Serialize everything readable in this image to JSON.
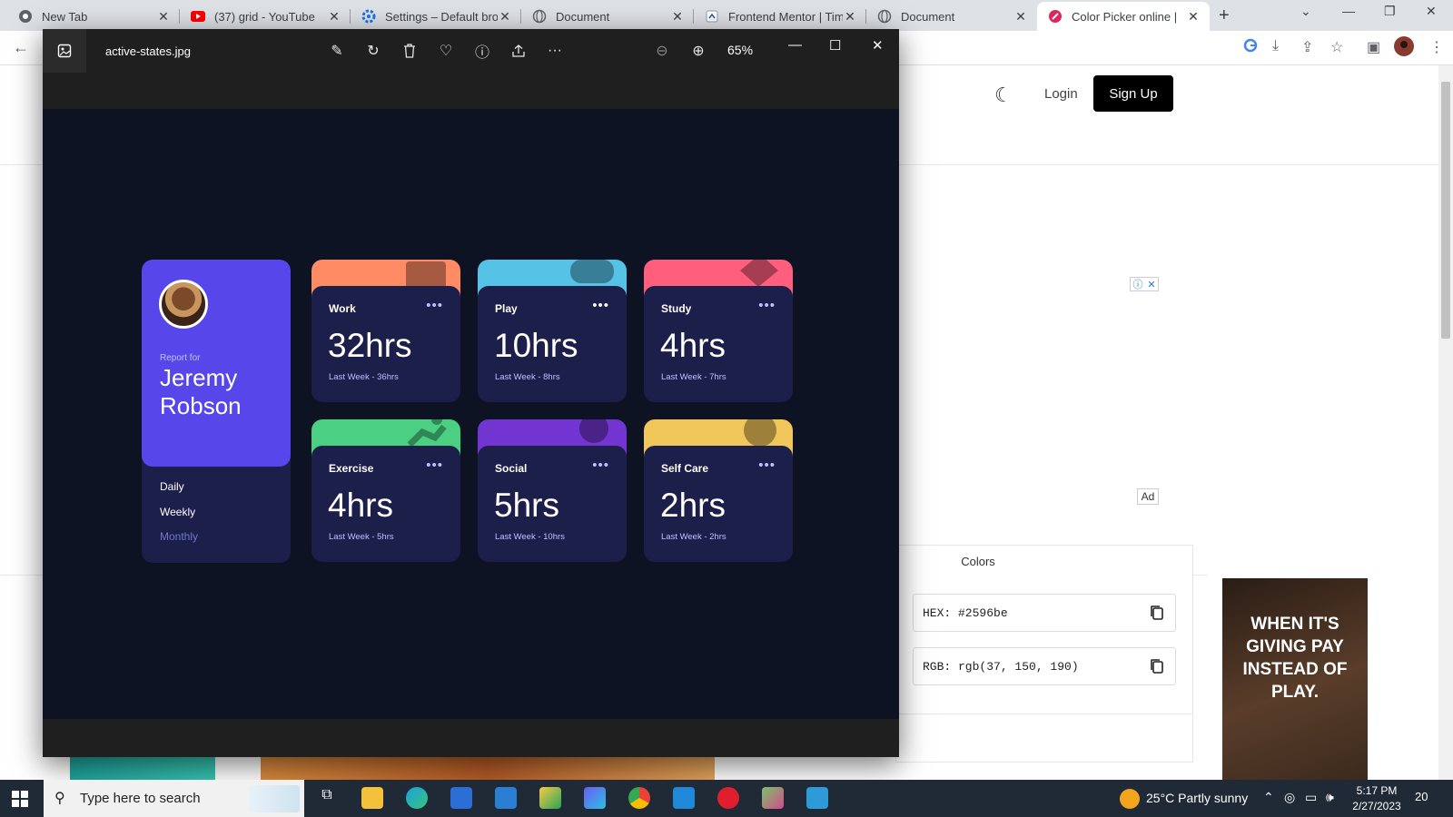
{
  "browser": {
    "tabs": [
      {
        "title": "New Tab",
        "icon": "chrome-icon"
      },
      {
        "title": "(37) grid - YouTube",
        "icon": "youtube-icon"
      },
      {
        "title": "Settings – Default brow",
        "icon": "settings-icon"
      },
      {
        "title": "Document",
        "icon": "globe-icon"
      },
      {
        "title": "Frontend Mentor | Time",
        "icon": "frontend-mentor-icon"
      },
      {
        "title": "Document",
        "icon": "globe-icon"
      },
      {
        "title": "Color Picker online |",
        "icon": "color-picker-icon"
      }
    ],
    "new_tab_label": "+"
  },
  "site": {
    "login_label": "Login",
    "signup_label": "Sign Up",
    "ad_label": "Ad",
    "colors": {
      "title": "Colors",
      "hex": "HEX: #2596be",
      "rgb": "RGB: rgb(37, 150, 190)"
    },
    "ad_banner_text": "WHEN IT'S GIVING PAY INSTEAD OF PLAY."
  },
  "viewer": {
    "filename": "active-states.jpg",
    "zoom": "65%"
  },
  "dashboard": {
    "report_for": "Report for",
    "name": "Jeremy Robson",
    "periods": [
      "Daily",
      "Weekly",
      "Monthly"
    ],
    "period_colors": [
      "#ffffff",
      "#ffffff",
      "#7078c9"
    ],
    "cards": [
      {
        "label": "Work",
        "hours": "32hrs",
        "previous": "Last Week - 36hrs",
        "color": "#ff8b64"
      },
      {
        "label": "Play",
        "hours": "10hrs",
        "previous": "Last Week - 8hrs",
        "color": "#55c2e6"
      },
      {
        "label": "Study",
        "hours": "4hrs",
        "previous": "Last Week - 7hrs",
        "color": "#ff5e7d"
      },
      {
        "label": "Exercise",
        "hours": "4hrs",
        "previous": "Last Week - 5hrs",
        "color": "#4bcf82"
      },
      {
        "label": "Social",
        "hours": "5hrs",
        "previous": "Last Week - 10hrs",
        "color": "#7335d2"
      },
      {
        "label": "Self Care",
        "hours": "2hrs",
        "previous": "Last Week - 2hrs",
        "color": "#f1c75b"
      }
    ],
    "menu_glyph": "•••"
  },
  "taskbar": {
    "search_placeholder": "Type here to search",
    "weather": "25°C  Partly sunny",
    "time": "5:17 PM",
    "date": "2/27/2023",
    "notification_count": "20"
  }
}
